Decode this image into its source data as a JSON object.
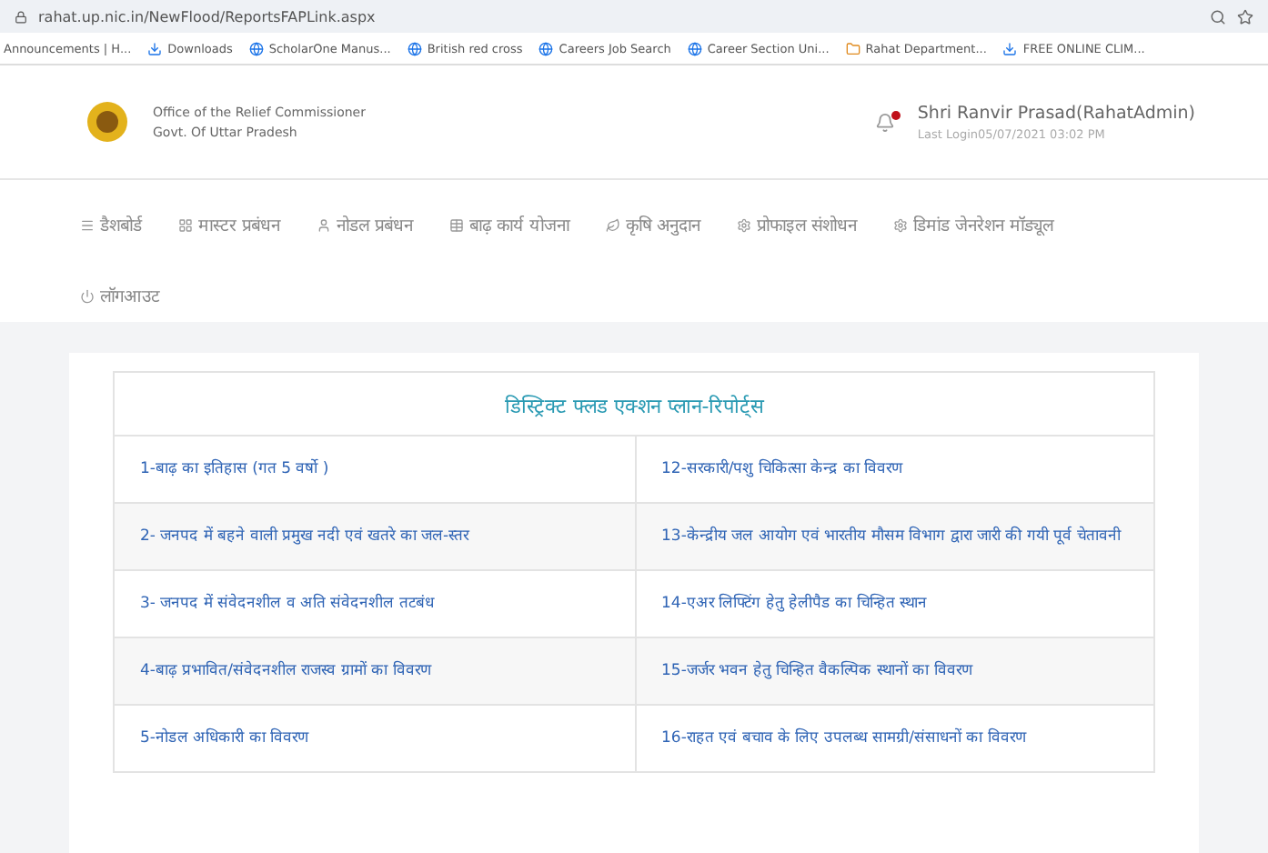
{
  "browser": {
    "url": "rahat.up.nic.in/NewFlood/ReportsFAPLink.aspx",
    "bookmarks": [
      "Announcements | H...",
      "Downloads",
      "ScholarOne Manus...",
      "British red cross",
      "Careers Job Search",
      "Career Section Uni...",
      "Rahat Department...",
      "FREE ONLINE CLIM..."
    ]
  },
  "header": {
    "org_name": "Office of the Relief Commissioner",
    "org_sub": "Govt. Of Uttar Pradesh",
    "notification_unread": true,
    "user_name": "Shri Ranvir Prasad(RahatAdmin)",
    "last_login": "Last Login05/07/2021 03:02 PM"
  },
  "nav": [
    {
      "label": "डैशबोर्ड",
      "kind": "menu"
    },
    {
      "label": "मास्टर प्रबंधन",
      "kind": "grid"
    },
    {
      "label": "नोडल प्रबंधन",
      "kind": "user"
    },
    {
      "label": "बाढ़ कार्य योजना",
      "kind": "table"
    },
    {
      "label": "कृषि अनुदान",
      "kind": "leaf"
    },
    {
      "label": "प्रोफाइल संशोधन",
      "kind": "gear"
    },
    {
      "label": "डिमांड जेनरेशन मॉड्यूल",
      "kind": "gear"
    },
    {
      "label": "लॉगआउट",
      "kind": "power"
    }
  ],
  "reports": {
    "title": "डिस्ट्रिक्ट फ्लड एक्शन प्लान-रिपोर्ट्स",
    "rows": [
      [
        "1-बाढ़ का इतिहास (गत 5 वर्षो )",
        "12-सरकारी/पशु चिकित्सा केन्द्र का विवरण"
      ],
      [
        "2- जनपद में बहने वाली प्रमुख नदी एवं खतरे का जल-स्तर",
        "13-केन्द्रीय जल आयोग एवं भारतीय मौसम विभाग द्वारा जारी की गयी पूर्व चेतावनी"
      ],
      [
        "3- जनपद में संवेदनशील व अति संवेदनशील तटबंध",
        "14-एअर लिफ्टिंग हेतु हेलीपैड का चिन्हित स्थान"
      ],
      [
        "4-बाढ़ प्रभावित/संवेदनशील राजस्व ग्रामों का विवरण",
        "15-जर्जर भवन हेतु चिन्हित वैकल्पिक स्थानों का विवरण"
      ],
      [
        "5-नोडल अधिकारी का विवरण",
        "16-राहत एवं बचाव के लिए उपलब्ध सामग्री/संसाधनों का विवरण"
      ]
    ]
  }
}
